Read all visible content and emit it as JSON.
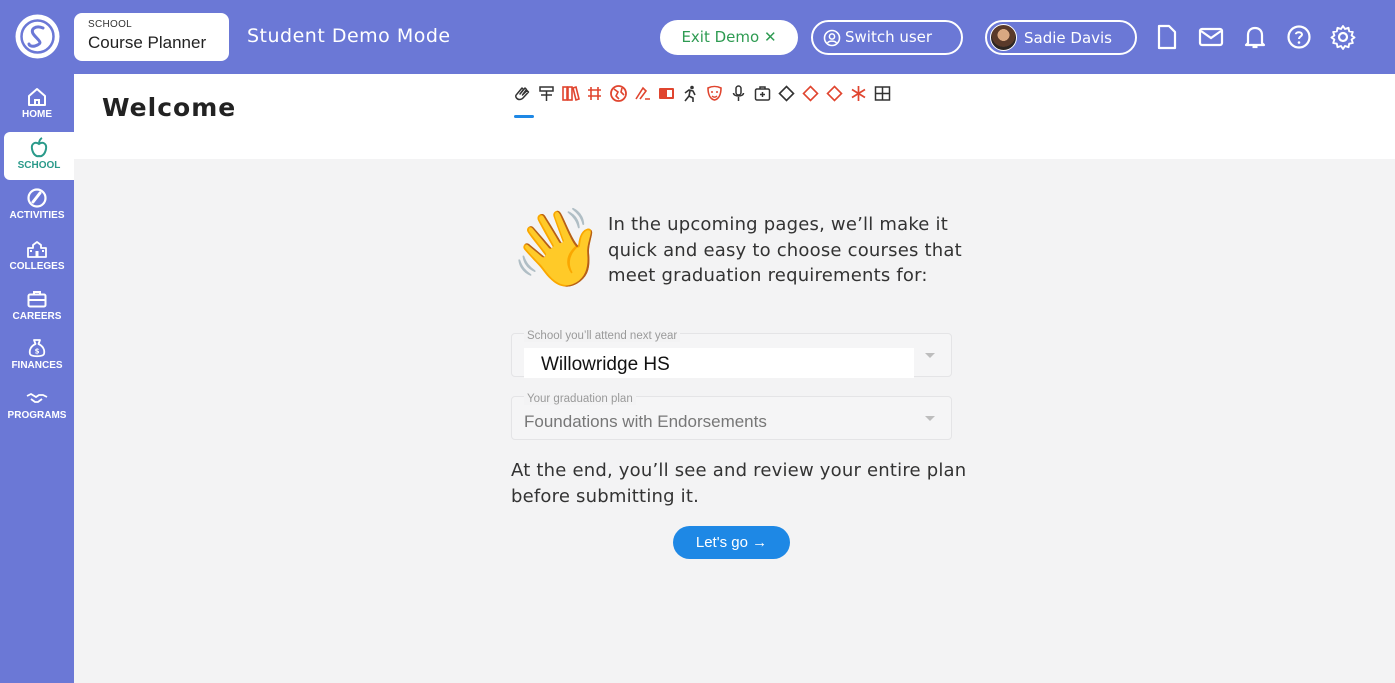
{
  "topbar": {
    "app_chip_small": "SCHOOL",
    "app_chip_big": "Course Planner",
    "mode_title": "Student Demo Mode",
    "exit_demo_label": "Exit Demo ✕",
    "switch_user_label": "Switch user",
    "user_name": "Sadie Davis",
    "icons": [
      "document-icon",
      "mail-icon",
      "bell-icon",
      "help-icon",
      "settings-icon"
    ]
  },
  "sidebar": {
    "items": [
      {
        "label": "HOME",
        "icon": "home-icon"
      },
      {
        "label": "SCHOOL",
        "icon": "apple-icon"
      },
      {
        "label": "ACTIVITIES",
        "icon": "activities-icon"
      },
      {
        "label": "COLLEGES",
        "icon": "college-icon"
      },
      {
        "label": "CAREERS",
        "icon": "briefcase-icon"
      },
      {
        "label": "FINANCES",
        "icon": "money-bag-icon"
      },
      {
        "label": "PROGRAMS",
        "icon": "handshake-icon"
      }
    ]
  },
  "header": {
    "title": "Welcome",
    "step_icons": [
      "👋",
      "亭",
      "𝌆",
      "⁂",
      "◉",
      "✍",
      "▣",
      "🏃",
      "◎",
      "♀",
      "⊞",
      "◇",
      "◇",
      "◇",
      "✱",
      "⊞"
    ]
  },
  "main": {
    "intro_text": "In the upcoming pages, we’ll make it quick and easy to choose courses that meet graduation requirements for:",
    "school_field": {
      "label": "School you’ll attend next year",
      "value": "Willowridge HS"
    },
    "plan_field": {
      "label": "Your graduation plan",
      "value": "Foundations with Endorsements"
    },
    "outro_text": "At the end, you’ll see and review your entire plan before submitting it.",
    "go_label": "Let's go →"
  },
  "colors": {
    "brand": "#6b78d6",
    "primary": "#1e88e5",
    "exit_green": "#2e9b52",
    "step_red": "#e0452f",
    "active_teal": "#2a9a8a"
  }
}
